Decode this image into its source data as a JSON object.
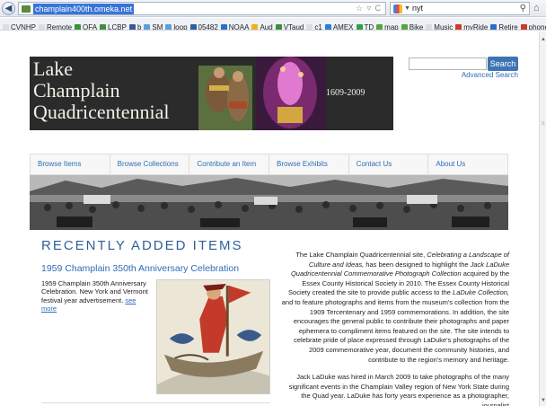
{
  "browser": {
    "url": "champlain400th.omeka.net",
    "search_query": "nyt",
    "bookmarks": [
      {
        "label": "CVNHP",
        "color": "#d9dde4"
      },
      {
        "label": "Remote",
        "color": "#d9dde4"
      },
      {
        "label": "OFA",
        "color": "#3f8f3f"
      },
      {
        "label": "LCBP",
        "color": "#3f8f3f"
      },
      {
        "label": "b",
        "color": "#3b5998"
      },
      {
        "label": "SM",
        "color": "#5aa0d8"
      },
      {
        "label": "loop",
        "color": "#5aa0d8"
      },
      {
        "label": "05482",
        "color": "#2a5fa8"
      },
      {
        "label": "NOAA",
        "color": "#2a6fd0"
      },
      {
        "label": "Aud",
        "color": "#f0b020"
      },
      {
        "label": "VTaud",
        "color": "#3a8f3a"
      },
      {
        "label": "c1",
        "color": "#d9dde4"
      },
      {
        "label": "AMEX",
        "color": "#2a7fd0"
      },
      {
        "label": "TD",
        "color": "#2fa04a"
      },
      {
        "label": "map",
        "color": "#58a43c"
      },
      {
        "label": "Bike",
        "color": "#58a43c"
      },
      {
        "label": "Music",
        "color": "#d9dde4"
      },
      {
        "label": "myRide",
        "color": "#d03a2a"
      },
      {
        "label": "Retire",
        "color": "#2a6fd0"
      },
      {
        "label": "phone",
        "color": "#d03a2a"
      }
    ]
  },
  "header": {
    "title_lines": [
      "Lake",
      "Champlain",
      "Quadricentennial"
    ],
    "years": "1609-2009"
  },
  "site_search": {
    "button_label": "Search",
    "advanced_label": "Advanced Search"
  },
  "nav": {
    "items": [
      "Browse Items",
      "Browse Collections",
      "Contribute an Item",
      "Browse Exhibits",
      "Contact Us",
      "About Us"
    ]
  },
  "recent": {
    "heading": "RECENTLY ADDED ITEMS",
    "item_title": "1959 Champlain 350th Anniversary Celebration",
    "item_desc": "1959 Champlain 350th Anniversary Celebration. New York and Vermont festival year advertisement.",
    "see_more": "see more"
  },
  "intro": {
    "p1_a": "The Lake Champlain Quadricentennial site, ",
    "p1_b": "Celebrating a Landscape of Culture and Ideas,",
    "p1_c": " has been designed to highlight the ",
    "p1_d": "Jack LaDuke Quadricentennial Commemorative Photograph Collection",
    "p1_e": " acquired by the Essex County Historical Society in 2010. The Essex County Historical Society created the site to provide public access to the ",
    "p1_f": "LaDuke Collection,",
    "p1_g": " and to feature photographs and items from the museum's collection from the 1909 Tercentenary and 1959 commemorations. In addition, the site encourages the general public to contribute their photographs and paper ephemera to compliment items featured on the site. The site intends to celebrate pride of place expressed through LaDuke's photographs of the 2009 commemorative year, document the community histories, and contribute to the region's memory and heritage.",
    "p2": "Jack LaDuke was hired in March 2009 to take photographs of the many significant events in the Champlain Valley region of New York State during the Quad year. LaDuke has forty years experience as a photographer, journalist"
  }
}
